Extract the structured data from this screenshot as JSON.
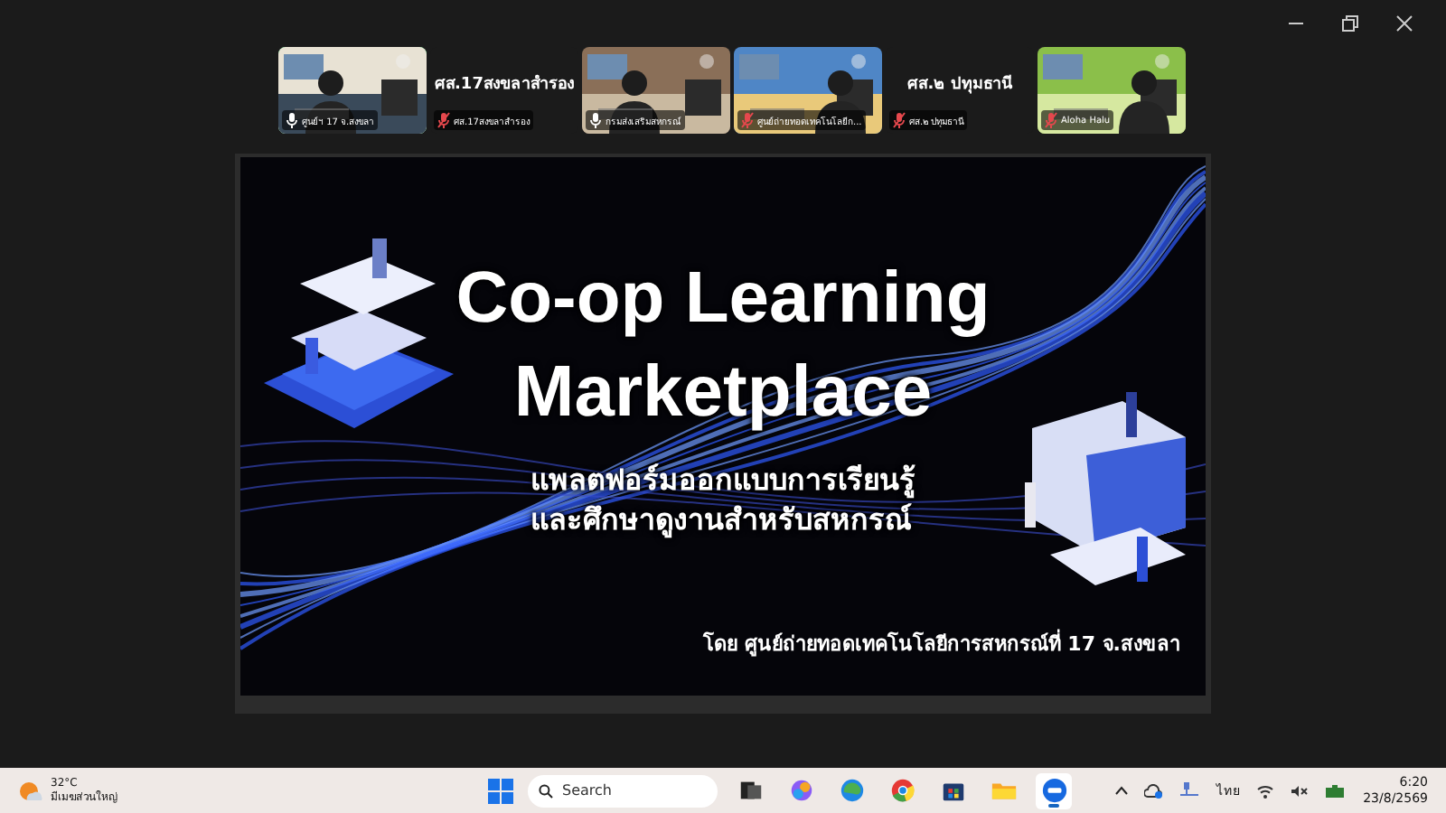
{
  "participants": [
    {
      "kind": "video",
      "name": "ศูนย์ฯ 17 จ.สงขลา",
      "muted": false,
      "speaking": true
    },
    {
      "kind": "name",
      "display": "ศส.17สงขลาสำรอง",
      "name": "ศส.17สงขลาสำรอง",
      "muted": true,
      "speaking": false
    },
    {
      "kind": "video",
      "name": "กรมส่งเสริมสหกรณ์",
      "muted": false,
      "speaking": false
    },
    {
      "kind": "video",
      "name": "ศูนย์ถ่ายทอดเทคโนโลยีก...",
      "muted": true,
      "speaking": false
    },
    {
      "kind": "name",
      "display": "ศส.๒ ปทุมธานี",
      "name": "ศส.๒ ปทุมธานี",
      "muted": true,
      "speaking": false
    },
    {
      "kind": "video",
      "name": "Aloha Halu",
      "muted": true,
      "speaking": false
    }
  ],
  "slide": {
    "title_lines": [
      "Co-op Learning",
      "Marketplace"
    ],
    "subtitle_lines": [
      "แพลตฟอร์มออกแบบการเรียนรู้",
      "และศึกษาดูงานสำหรับสหกรณ์"
    ],
    "footer": "โดย ศูนย์ถ่ายทอดเทคโนโลยีการสหกรณ์ที่ 17 จ.สงขลา"
  },
  "taskbar": {
    "weather": {
      "temperature": "32°C",
      "condition": "มีเมฆส่วนใหญ่"
    },
    "search": {
      "placeholder": "Search"
    },
    "apps": [
      {
        "kind": "taskview",
        "selected": false
      },
      {
        "kind": "copilot",
        "selected": false
      },
      {
        "kind": "edge",
        "selected": false
      },
      {
        "kind": "chrome",
        "selected": false
      },
      {
        "kind": "store",
        "selected": false
      },
      {
        "kind": "explorer",
        "selected": false
      },
      {
        "kind": "zoom",
        "selected": true
      }
    ],
    "language": "ไทย",
    "time": "6:20",
    "date": "23/8/2569"
  }
}
